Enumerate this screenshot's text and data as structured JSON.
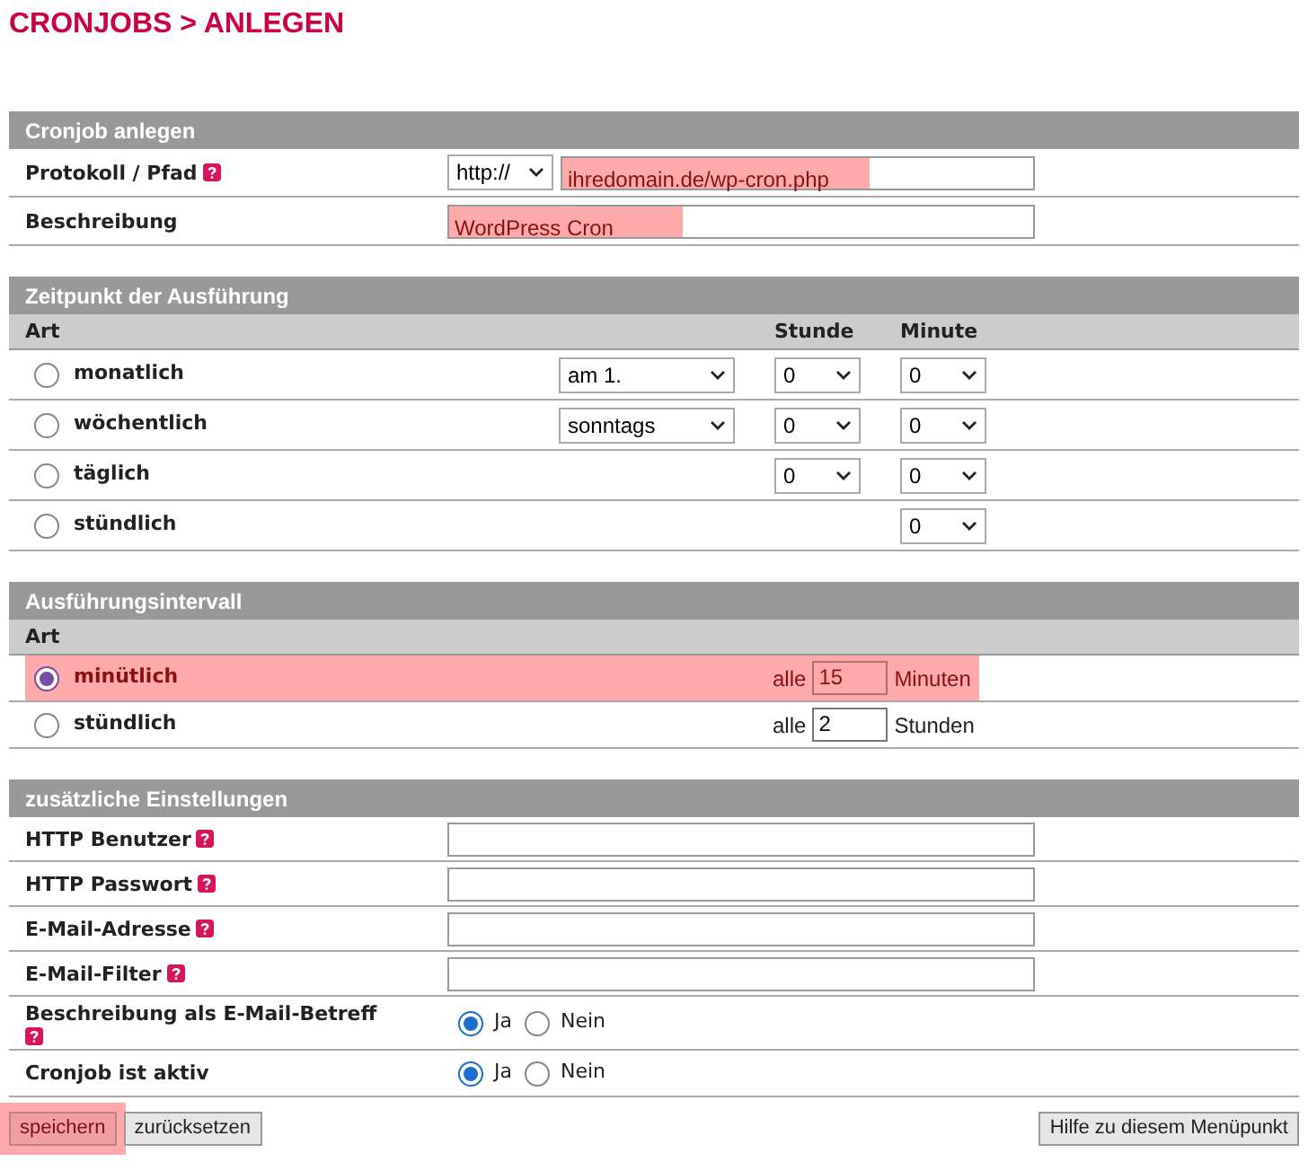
{
  "title": "CRONJOBS > ANLEGEN",
  "create": {
    "title": "Cronjob anlegen",
    "rows": [
      {
        "kind": "url",
        "label": "Protokoll / Pfad",
        "help": true,
        "protocol": "http://",
        "value": "ihredomain.de/wp-cron.php",
        "highlighted": true
      },
      {
        "kind": "text",
        "label": "Beschreibung",
        "help": false,
        "value": "WordPress Cron",
        "highlighted": true
      }
    ]
  },
  "schedule": {
    "title": "Zeitpunkt der Ausführung",
    "columns": [
      "Art",
      "Stunde",
      "Minute"
    ],
    "options": [
      {
        "label": "monatlich",
        "selected": false,
        "day": "am 1.",
        "hour": "0",
        "minute": "0"
      },
      {
        "label": "wöchentlich",
        "selected": false,
        "day": "sonntags",
        "hour": "0",
        "minute": "0"
      },
      {
        "label": "täglich",
        "selected": false,
        "hour": "0",
        "minute": "0"
      },
      {
        "label": "stündlich",
        "selected": false,
        "minute": "0"
      }
    ]
  },
  "interval": {
    "title": "Ausführungsintervall",
    "column": "Art",
    "options": [
      {
        "label": "minütlich",
        "selected": true,
        "highlighted": true,
        "prefix": "alle",
        "value": "15",
        "unit": "Minuten"
      },
      {
        "label": "stündlich",
        "selected": false,
        "highlighted": false,
        "prefix": "alle",
        "value": "2",
        "unit": "Stunden"
      }
    ]
  },
  "extra": {
    "title": "zusätzliche Einstellungen",
    "rows": [
      {
        "kind": "text",
        "label": "HTTP Benutzer",
        "help": true
      },
      {
        "kind": "text",
        "label": "HTTP Passwort",
        "help": true
      },
      {
        "kind": "text",
        "label": "E-Mail-Adresse",
        "help": true
      },
      {
        "kind": "text",
        "label": "E-Mail-Filter",
        "help": true
      },
      {
        "kind": "choice",
        "label": "Beschreibung als E-Mail-Betreff",
        "help": true,
        "options": [
          {
            "label": "Ja",
            "selected": true
          },
          {
            "label": "Nein",
            "selected": false
          }
        ]
      },
      {
        "kind": "choice",
        "label": "Cronjob ist aktiv",
        "help": false,
        "options": [
          {
            "label": "Ja",
            "selected": true
          },
          {
            "label": "Nein",
            "selected": false
          }
        ]
      }
    ]
  },
  "buttons": [
    {
      "label": "speichern",
      "highlighted": true
    },
    {
      "label": "zurücksetzen",
      "highlighted": false
    },
    {
      "label": "Hilfe zu diesem Menüpunkt",
      "highlighted": false
    }
  ]
}
